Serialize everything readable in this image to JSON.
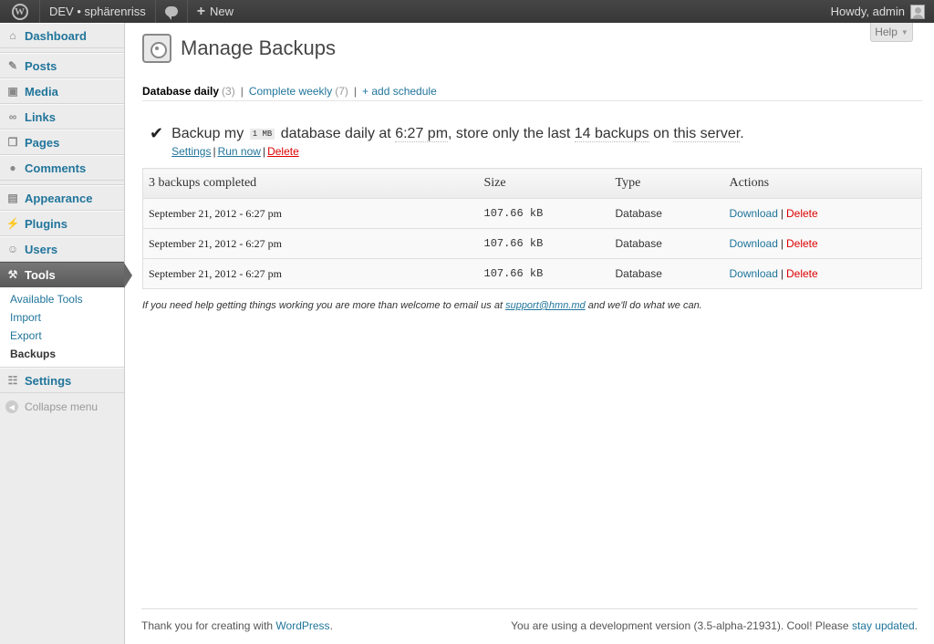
{
  "adminbar": {
    "site_name": "DEV • sphärenriss",
    "new_label": "New",
    "howdy": "Howdy, admin"
  },
  "sidebar": {
    "items": [
      {
        "label": "Dashboard",
        "icon": "dashboard-icon"
      },
      {
        "label": "Posts",
        "icon": "pin-icon"
      },
      {
        "label": "Media",
        "icon": "media-icon"
      },
      {
        "label": "Links",
        "icon": "link-icon"
      },
      {
        "label": "Pages",
        "icon": "pages-icon"
      },
      {
        "label": "Comments",
        "icon": "comment-icon"
      },
      {
        "label": "Appearance",
        "icon": "appearance-icon"
      },
      {
        "label": "Plugins",
        "icon": "plug-icon"
      },
      {
        "label": "Users",
        "icon": "users-icon"
      },
      {
        "label": "Tools",
        "icon": "tools-icon"
      },
      {
        "label": "Settings",
        "icon": "settings-icon"
      }
    ],
    "tools_submenu": [
      "Available Tools",
      "Import",
      "Export",
      "Backups"
    ],
    "collapse_label": "Collapse menu"
  },
  "help_label": "Help",
  "page_title": "Manage Backups",
  "tabs": {
    "current_label": "Database daily",
    "current_count": "(3)",
    "second_label": "Complete weekly",
    "second_count": "(7)",
    "add_label": "+ add schedule"
  },
  "schedule": {
    "text_before": "Backup my",
    "size_badge": "1 MB",
    "text_type": "database",
    "text_freq": "daily at",
    "text_time": "6:27 pm",
    "text_mid": ", store only the last",
    "text_count": "14 backups",
    "text_end": "on",
    "text_dest": "this server",
    "text_period": ".",
    "settings_link": "Settings",
    "run_link": "Run now",
    "delete_link": "Delete"
  },
  "table": {
    "headers": [
      "3 backups completed",
      "Size",
      "Type",
      "Actions"
    ],
    "rows": [
      {
        "date": "September 21, 2012 - 6:27 pm",
        "size": "107.66 kB",
        "type": "Database"
      },
      {
        "date": "September 21, 2012 - 6:27 pm",
        "size": "107.66 kB",
        "type": "Database"
      },
      {
        "date": "September 21, 2012 - 6:27 pm",
        "size": "107.66 kB",
        "type": "Database"
      }
    ],
    "download_label": "Download",
    "delete_label": "Delete"
  },
  "help_note": {
    "before": "If you need help getting things working you are more than welcome to email us at",
    "email": "support@hmn.md",
    "after": "and we'll do what we can."
  },
  "footer": {
    "left_text": "Thank you for creating with",
    "left_link": "WordPress",
    "left_end": ".",
    "right_text": "You are using a development version (3.5-alpha-21931). Cool! Please",
    "right_link": "stay updated",
    "right_end": "."
  },
  "colors": {
    "link": "#21759b",
    "delete": "#dd0000",
    "active_menu": "#666666"
  }
}
